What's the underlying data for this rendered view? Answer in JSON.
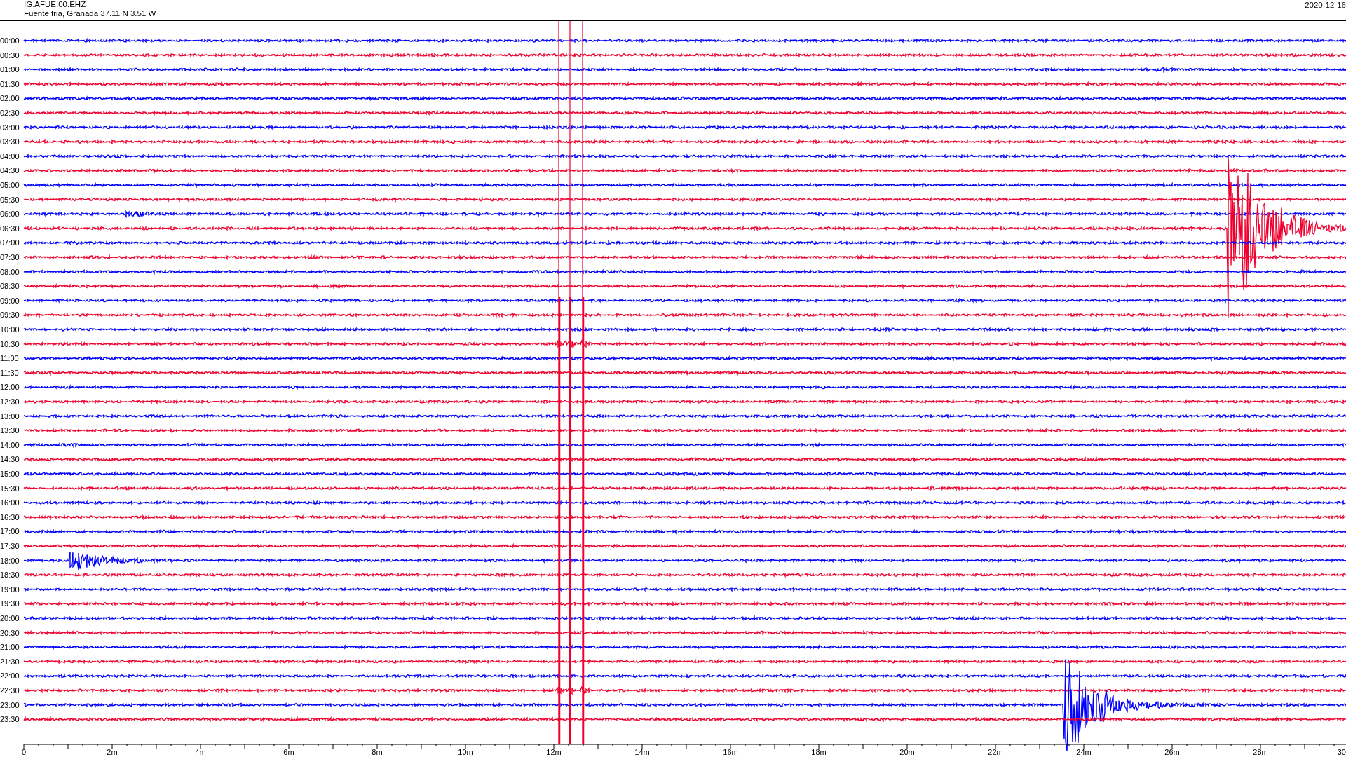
{
  "header": {
    "station": "IG.AFUE.00.EHZ",
    "location": "Fuente fria, Granada  37.11 N 3.51 W",
    "date": "2020-12-16"
  },
  "rows": [
    {
      "time": "00:00",
      "color": "#0000ff"
    },
    {
      "time": "00:30",
      "color": "#f0002e"
    },
    {
      "time": "01:00",
      "color": "#0000ff"
    },
    {
      "time": "01:30",
      "color": "#f0002e"
    },
    {
      "time": "02:00",
      "color": "#0000ff"
    },
    {
      "time": "02:30",
      "color": "#f0002e"
    },
    {
      "time": "03:00",
      "color": "#0000ff"
    },
    {
      "time": "03:30",
      "color": "#f0002e"
    },
    {
      "time": "04:00",
      "color": "#0000ff"
    },
    {
      "time": "04:30",
      "color": "#f0002e"
    },
    {
      "time": "05:00",
      "color": "#0000ff"
    },
    {
      "time": "05:30",
      "color": "#f0002e"
    },
    {
      "time": "06:00",
      "color": "#0000ff"
    },
    {
      "time": "06:30",
      "color": "#f0002e"
    },
    {
      "time": "07:00",
      "color": "#0000ff"
    },
    {
      "time": "07:30",
      "color": "#f0002e"
    },
    {
      "time": "08:00",
      "color": "#0000ff"
    },
    {
      "time": "08:30",
      "color": "#f0002e"
    },
    {
      "time": "09:00",
      "color": "#0000ff"
    },
    {
      "time": "09:30",
      "color": "#f0002e"
    },
    {
      "time": "10:00",
      "color": "#0000ff"
    },
    {
      "time": "10:30",
      "color": "#f0002e"
    },
    {
      "time": "11:00",
      "color": "#0000ff"
    },
    {
      "time": "11:30",
      "color": "#f0002e"
    },
    {
      "time": "12:00",
      "color": "#0000ff"
    },
    {
      "time": "12:30",
      "color": "#f0002e"
    },
    {
      "time": "13:00",
      "color": "#0000ff"
    },
    {
      "time": "13:30",
      "color": "#f0002e"
    },
    {
      "time": "14:00",
      "color": "#0000ff"
    },
    {
      "time": "14:30",
      "color": "#f0002e"
    },
    {
      "time": "15:00",
      "color": "#0000ff"
    },
    {
      "time": "15:30",
      "color": "#f0002e"
    },
    {
      "time": "16:00",
      "color": "#0000ff"
    },
    {
      "time": "16:30",
      "color": "#f0002e"
    },
    {
      "time": "17:00",
      "color": "#0000ff"
    },
    {
      "time": "17:30",
      "color": "#f0002e"
    },
    {
      "time": "18:00",
      "color": "#0000ff"
    },
    {
      "time": "18:30",
      "color": "#f0002e"
    },
    {
      "time": "19:00",
      "color": "#0000ff"
    },
    {
      "time": "19:30",
      "color": "#f0002e"
    },
    {
      "time": "20:00",
      "color": "#0000ff"
    },
    {
      "time": "20:30",
      "color": "#f0002e"
    },
    {
      "time": "21:00",
      "color": "#0000ff"
    },
    {
      "time": "21:30",
      "color": "#f0002e"
    },
    {
      "time": "22:00",
      "color": "#0000ff"
    },
    {
      "time": "22:30",
      "color": "#f0002e"
    },
    {
      "time": "23:00",
      "color": "#0000ff"
    },
    {
      "time": "23:30",
      "color": "#f0002e"
    }
  ],
  "x_axis": {
    "ticks": [
      "0",
      "2m",
      "4m",
      "6m",
      "8m",
      "10m",
      "12m",
      "14m",
      "16m",
      "18m",
      "20m",
      "22m",
      "24m",
      "26m",
      "28m",
      "30"
    ]
  }
}
